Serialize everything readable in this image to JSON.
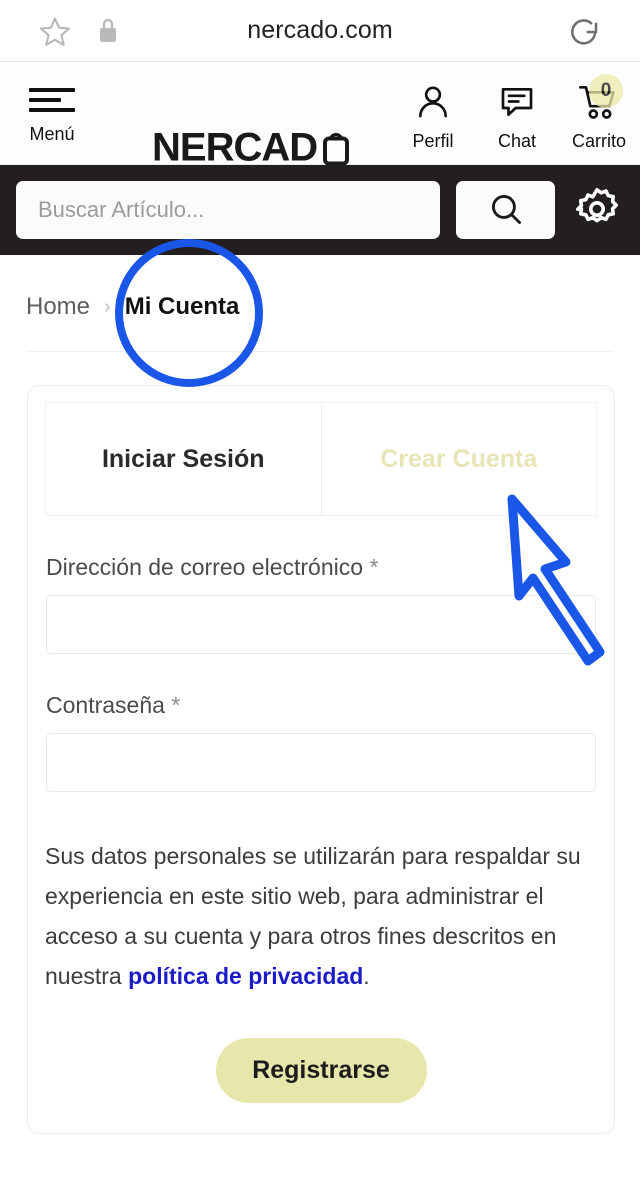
{
  "browser": {
    "url": "nercado.com",
    "bookmark_icon": "star-icon",
    "security_icon": "lock-icon",
    "reload_icon": "reload-icon"
  },
  "header": {
    "menu_label": "Menú",
    "menu_icon": "hamburger-icon",
    "brand": "NERCAD",
    "brand_bag_icon": "shopping-bag-icon",
    "actions": [
      {
        "label": "Perfil",
        "icon": "user-icon"
      },
      {
        "label": "Chat",
        "icon": "chat-bubble-icon"
      },
      {
        "label": "Carrito",
        "icon": "shopping-cart-icon",
        "badge": "0"
      }
    ]
  },
  "search": {
    "placeholder": "Buscar Artículo...",
    "search_icon": "search-icon",
    "settings_icon": "gear-icon"
  },
  "breadcrumb": {
    "home": "Home",
    "separator": "›",
    "current": "Mi Cuenta"
  },
  "account_card": {
    "tabs": [
      {
        "label": "Iniciar Sesión",
        "active": true
      },
      {
        "label": "Crear Cuenta",
        "active": false
      }
    ],
    "fields": [
      {
        "label": "Dirección de correo electrónico",
        "required_marker": "*",
        "value": "",
        "placeholder": ""
      },
      {
        "label": "Contraseña",
        "required_marker": "*",
        "value": "",
        "placeholder": ""
      }
    ],
    "privacy": {
      "text_before": "Sus datos personales se utilizarán para respaldar su experiencia en este sitio web, para administrar el acceso a su cuenta y para otros fines descritos en nuestra ",
      "link_text": "política de privacidad",
      "text_after": "."
    },
    "submit_label": "Registrarse"
  },
  "annotations": {
    "circle_target": "Mi Cuenta",
    "cursor_target": "Crear Cuenta"
  },
  "colors": {
    "accent_yellow": "#e7e7ab",
    "tab_inactive_text": "#e7e5b6",
    "annotation_blue": "#1a56e8",
    "link_blue": "#1b1bc8",
    "search_bar_bg": "#231f20"
  }
}
